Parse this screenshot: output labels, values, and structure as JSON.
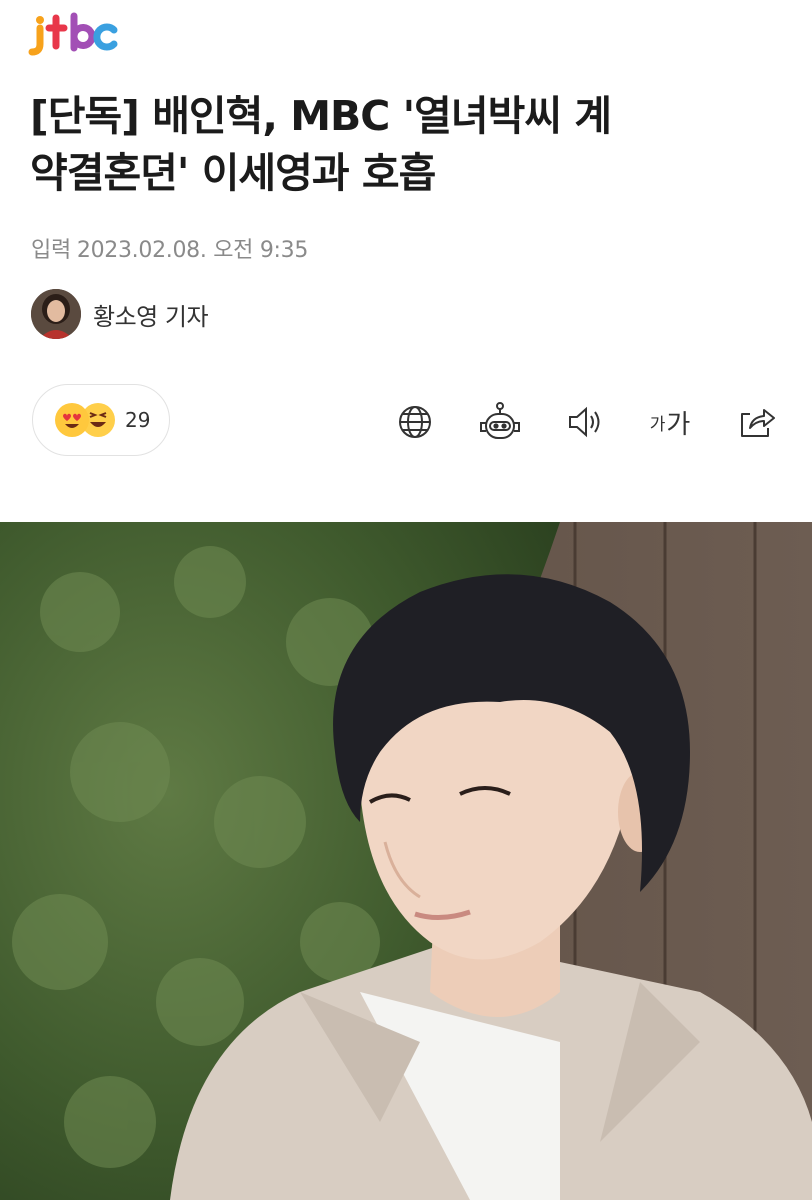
{
  "brand": {
    "logo_text": "jtbc"
  },
  "article": {
    "headline_line1": "[단독] 배인혁, MBC '열녀박씨 계",
    "headline_line2": "약결혼뎐' 이세영과 호흡",
    "published_label": "입력",
    "published_datetime": "2023.02.08. 오전 9:35",
    "reporter": "황소영 기자"
  },
  "reactions": {
    "emojis": [
      "heart-eyes-emoji",
      "laughing-emoji"
    ],
    "count": "29"
  },
  "toolbar": {
    "icons": [
      "globe-icon",
      "robot-summary-icon",
      "speaker-icon",
      "font-size-icon",
      "share-icon"
    ],
    "font_small": "가",
    "font_large": "가"
  },
  "photo": {
    "subject": "man-in-beige-blazer-photo"
  }
}
